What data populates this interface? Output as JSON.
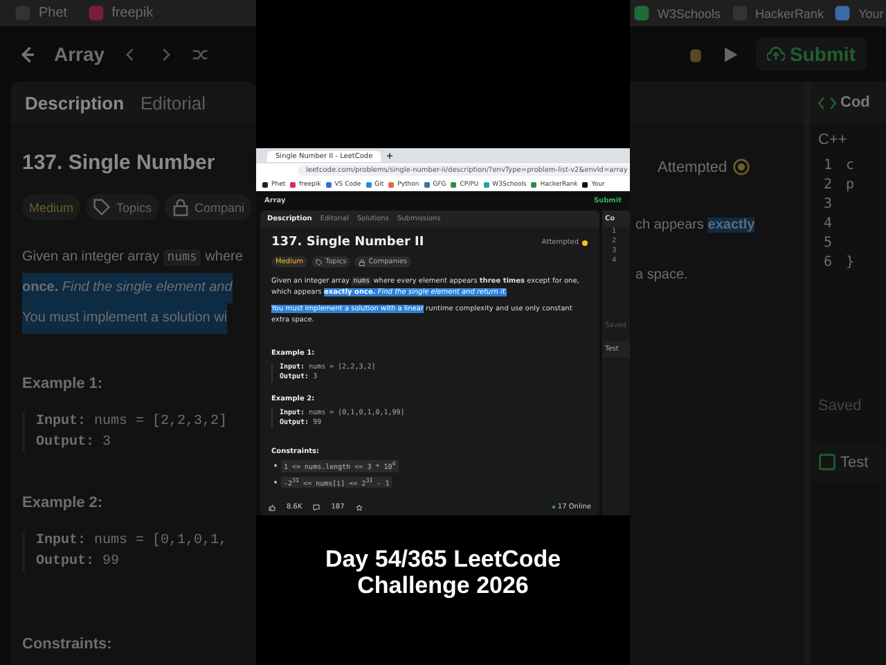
{
  "background_left": {
    "bookmarks": [
      "Phet",
      "freepik"
    ],
    "problem_list": "Array",
    "tabs": [
      {
        "label": "Description",
        "selected": true
      },
      {
        "label": "Editorial",
        "selected": false
      }
    ],
    "title": "137. Single Number",
    "tags": [
      {
        "label": "Medium",
        "kind": "difficulty"
      },
      {
        "label": "Topics",
        "kind": "topics"
      },
      {
        "label": "Compani",
        "kind": "companies"
      }
    ],
    "description": [
      {
        "text": "Given an integer array",
        "code": "nums",
        "after": "where",
        "highlighted": false
      },
      {
        "text": "**once.** *Find the single element and*",
        "highlighted": true
      },
      {
        "text": "You must implement a solution wi",
        "highlighted": true
      }
    ],
    "examples": [
      {
        "heading": "Example 1:",
        "input_label": "Input:",
        "input": "nums = [2,2,3,2]",
        "output_label": "Output:",
        "output": "3"
      },
      {
        "heading": "Example 2:",
        "input_label": "Input:",
        "input": "nums = [0,1,0,1,",
        "output_label": "Output:",
        "output": "99"
      }
    ],
    "constraints_heading": "Constraints:"
  },
  "background_right": {
    "bookmarks": [
      "W3Schools",
      "HackerRank",
      "Your"
    ],
    "submit": "Submit",
    "status": "Attempted",
    "description": [
      {
        "text": "ch appears",
        "highlight": "exactly"
      },
      {
        "text": "a space."
      }
    ],
    "code_tab": "Cod",
    "language": "C++",
    "code_lines": [
      {
        "number": "1",
        "code": "c"
      },
      {
        "number": "2",
        "code": "p"
      },
      {
        "number": "3"
      },
      {
        "number": "4"
      },
      {
        "number": "5"
      },
      {
        "number": "6",
        "code": "}"
      }
    ],
    "save_status": "Saved",
    "test_tab": "Test"
  },
  "screenshot": {
    "browser_tab": "Single Number II - LeetCode",
    "url": "leetcode.com/problems/single-number-ii/description/?envType=problem-list-v2&envId=array",
    "bookmarks": [
      "Phet",
      "freepik",
      "VS Code",
      "Git",
      "Python",
      "GFG",
      "CP/PU",
      "W3Schools",
      "HackerRank",
      "Your"
    ],
    "problem_list": "Array",
    "submit": "Submit",
    "tabs": [
      {
        "label": "Description",
        "selected": true
      },
      {
        "label": "Editorial",
        "selected": false
      },
      {
        "label": "Solutions",
        "selected": false
      },
      {
        "label": "Submissions",
        "selected": false
      }
    ],
    "title": "137. Single Number II",
    "status": "Attempted",
    "tags": [
      {
        "label": "Medium",
        "kind": "difficulty"
      },
      {
        "label": "Topics",
        "kind": "topics"
      },
      {
        "label": "Companies",
        "kind": "companies"
      }
    ],
    "paragraphs": [
      [
        {
          "text": "Given an integer array ",
          "kind": "plain"
        },
        {
          "text": "nums",
          "kind": "code"
        },
        {
          "text": " where every element appears ",
          "kind": "plain"
        },
        {
          "text": "three times",
          "kind": "bold"
        },
        {
          "text": " except for one, which appears ",
          "kind": "plain"
        },
        {
          "text": "exactly once.",
          "kind": "selected_bold"
        },
        {
          "text": " Find the single element and return it.",
          "kind": "selected_italic"
        }
      ],
      [
        {
          "text": "You must implement a solution with a linear",
          "kind": "selected"
        },
        {
          "text": " runtime complexity and use only constant extra space.",
          "kind": "plain"
        }
      ]
    ],
    "examples": [
      {
        "heading": "Example 1:",
        "input_label": "Input:",
        "input": "nums = [2,2,3,2]",
        "output_label": "Output:",
        "output": "3"
      },
      {
        "heading": "Example 2:",
        "input_label": "Input:",
        "input": "nums = [0,1,0,1,0,1,99]",
        "output_label": "Output:",
        "output": "99"
      }
    ],
    "constraints_heading": "Constraints:",
    "constraints": [
      "1 <= nums.length <= 3 * 10$^{4}$",
      "-2$^{31}$ <= nums[i] <= 2$^{31}$ - 1"
    ],
    "likes": "8.6K",
    "comments": "187",
    "online": "17 Online",
    "code_tab": "Co",
    "line_numbers": [
      "1",
      "2",
      "3",
      "4"
    ],
    "save_status": "Saved",
    "test_tab": "Test"
  },
  "caption": [
    "Day 54/365 LeetCode",
    "Challenge 2026"
  ]
}
